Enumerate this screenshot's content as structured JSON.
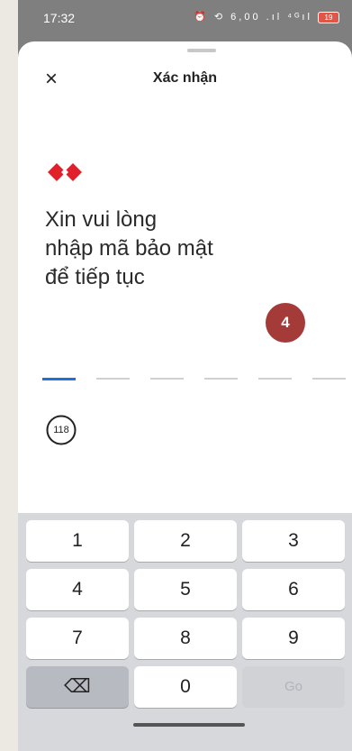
{
  "status_bar": {
    "time": "17:32",
    "icons_text": "⏰ ⟲ 6,00 .ıl ⁴ᴳıl",
    "battery": "19"
  },
  "header": {
    "close_symbol": "×",
    "title": "Xác nhận"
  },
  "brand": {
    "logo_color": "#e0202a"
  },
  "prompt": {
    "line1": "Xin vui lòng",
    "line2": "nhập mã bảo mật",
    "line3": "để tiếp tục"
  },
  "step_badge": "4",
  "pin": {
    "length": 6,
    "active_index": 0
  },
  "timer": {
    "seconds": "118"
  },
  "keypad": {
    "keys": [
      "1",
      "2",
      "3",
      "4",
      "5",
      "6",
      "7",
      "8",
      "9"
    ],
    "backspace_symbol": "⌫",
    "zero": "0",
    "go": "Go"
  },
  "colors": {
    "accent": "#1f6fe0",
    "badge": "#a43b39"
  }
}
